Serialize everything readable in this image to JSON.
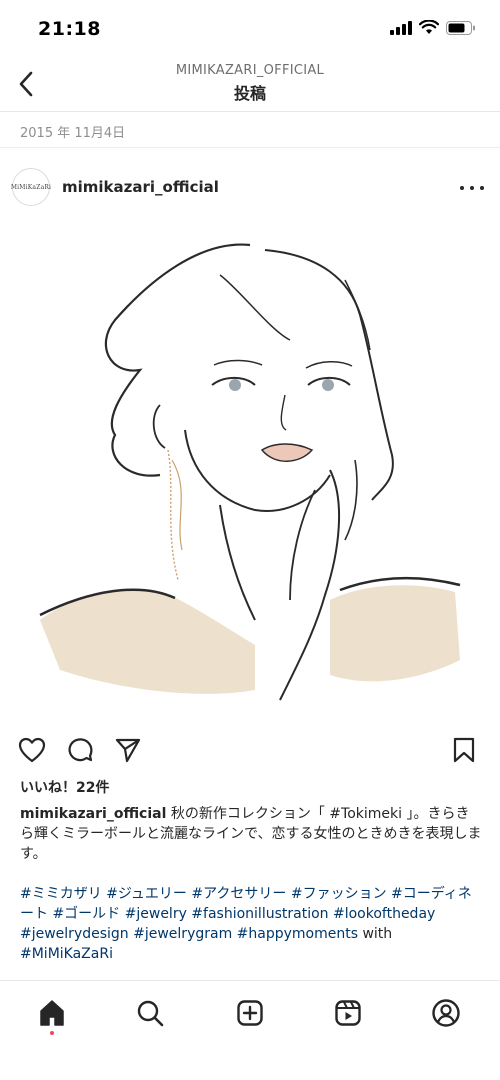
{
  "status_bar": {
    "time": "21:18"
  },
  "nav": {
    "subtitle": "MIMIKAZARI_OFFICIAL",
    "title": "投稿"
  },
  "post": {
    "date": "2015 年 11月4日",
    "avatar_text": "MiMiKaZaRi",
    "username": "mimikazari_official",
    "likes": "いいね！22件",
    "caption_user": "mimikazari_official",
    "caption_text": "秋の新作コレクション「 #Tokimeki 」。きらきら輝くミラーボールと流麗なラインで、恋する女性のときめきを表現します。",
    "hashtags_line": "#ミミカザリ #ジュエリー #アクセサリー #ファッション #コーディネート #ゴールド #jewelry #fashionillustration #lookoftheday  #jewelrydesign #jewelrygram #happymoments",
    "with_word": "with",
    "mention": "#MiMiKaZaRi"
  },
  "icons": {
    "back": "chevron-left-icon",
    "more": "more-horizontal-icon",
    "like": "heart-icon",
    "comment": "comment-icon",
    "share": "send-icon",
    "save": "bookmark-icon",
    "tabs": [
      "home-icon",
      "search-icon",
      "add-post-icon",
      "reels-icon",
      "profile-icon"
    ]
  },
  "colors": {
    "link": "#00376b",
    "text": "#262626",
    "muted": "#8e8e8e",
    "notification_dot": "#ed4956"
  }
}
